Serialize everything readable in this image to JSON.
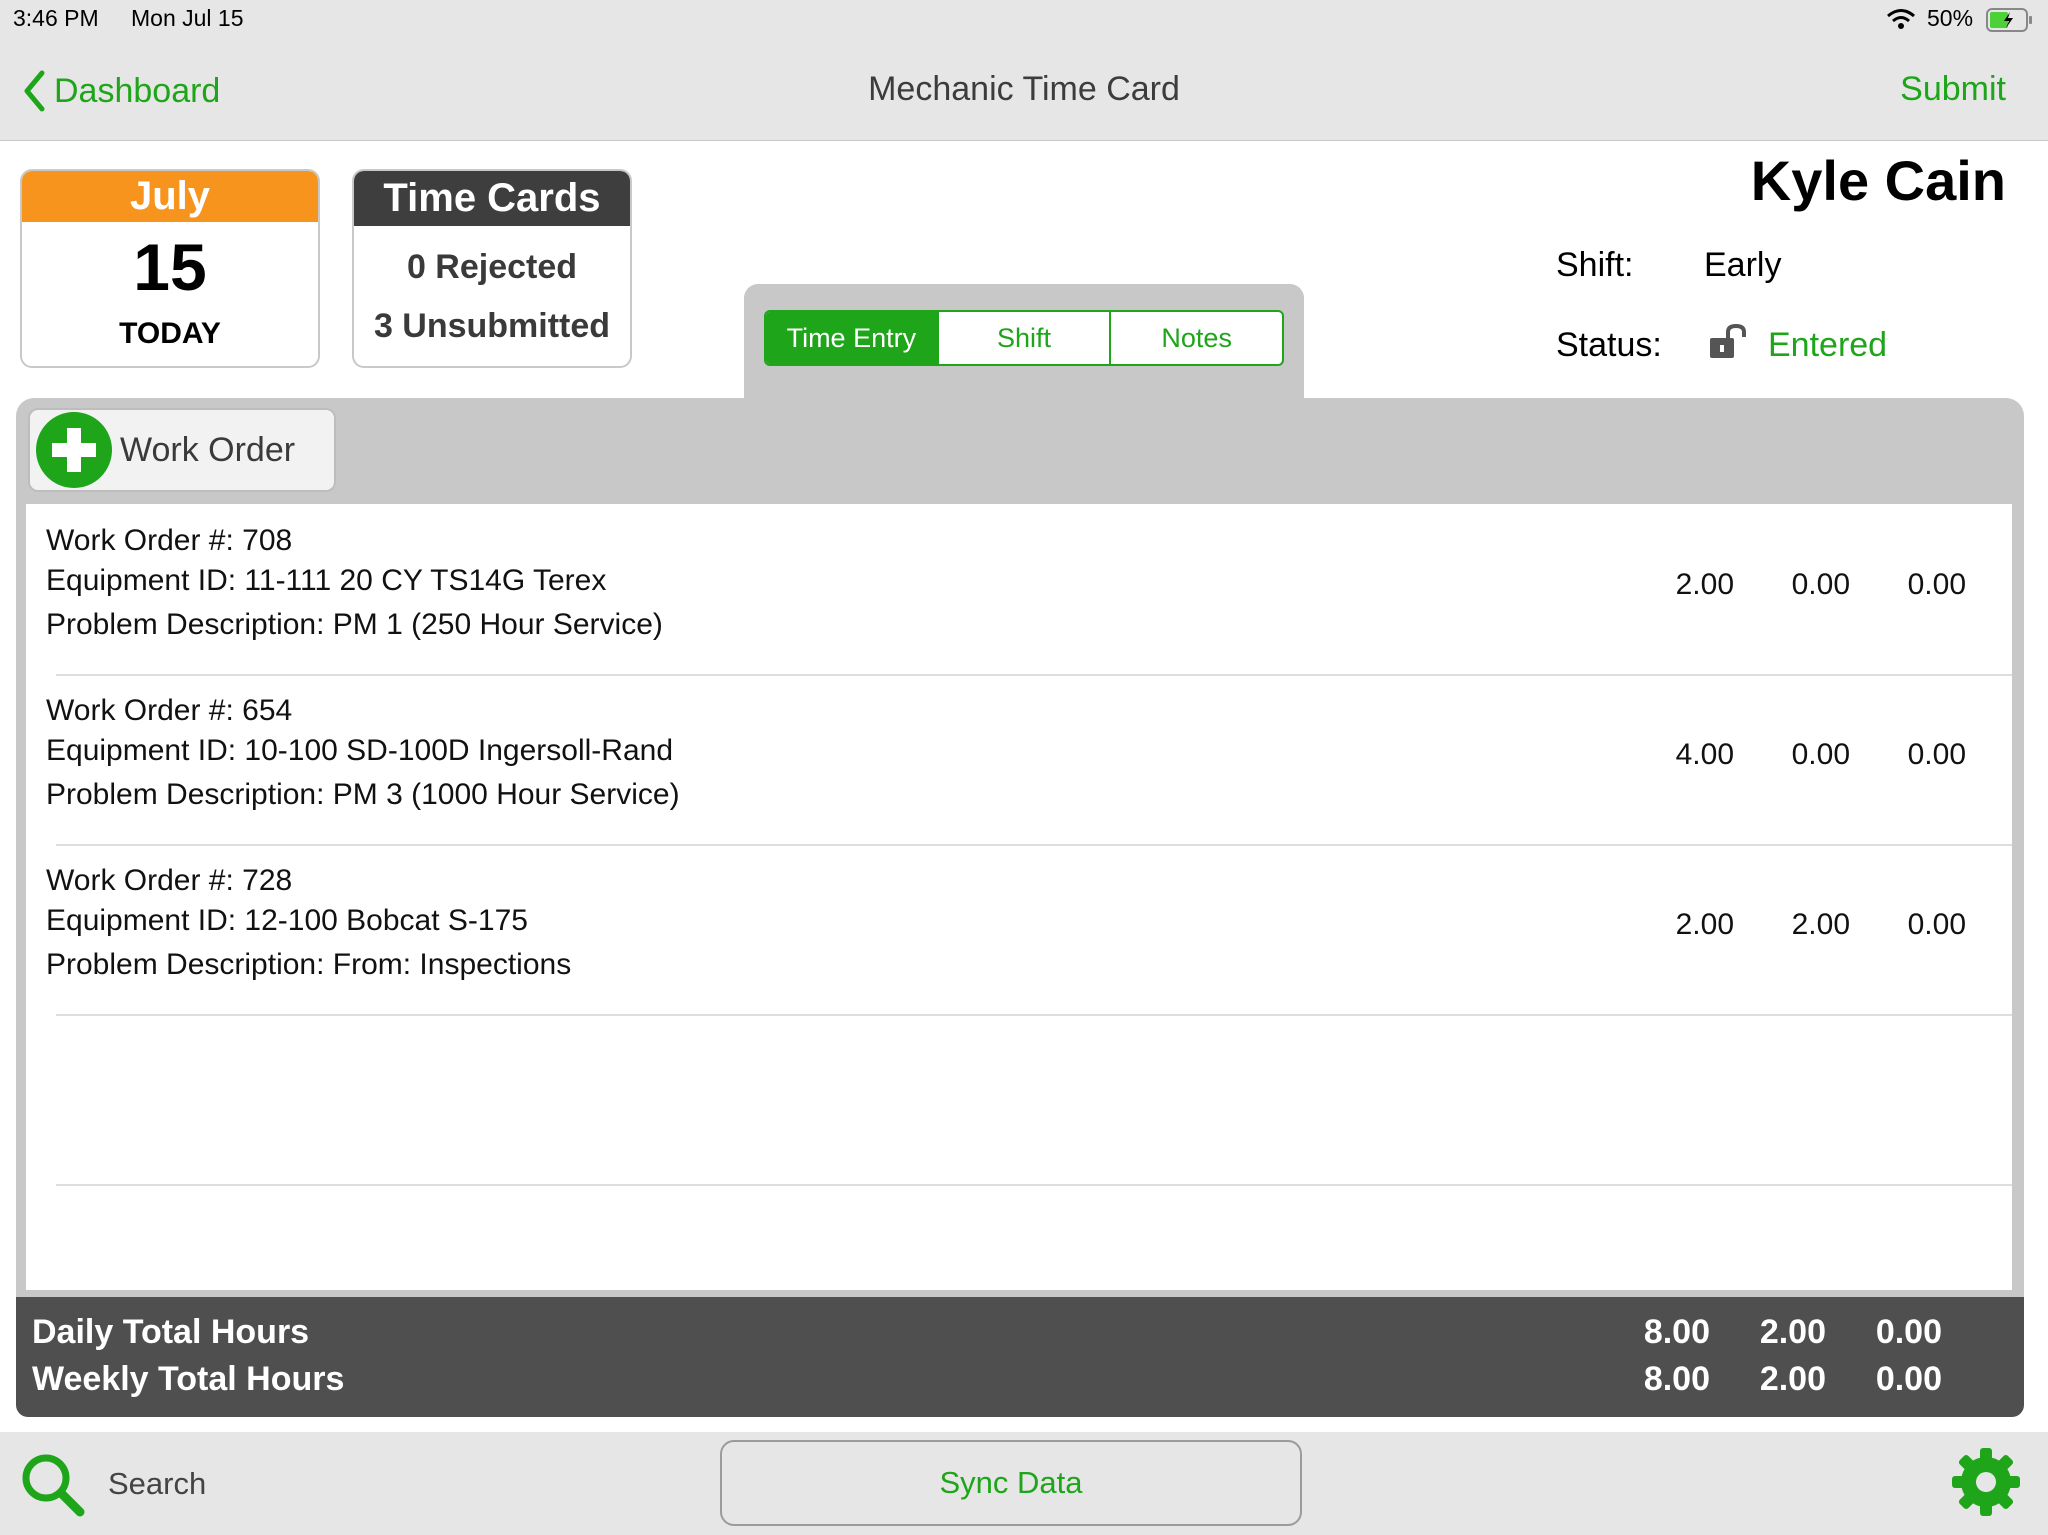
{
  "status_bar": {
    "time": "3:46 PM",
    "date": "Mon Jul 15",
    "battery": "50%"
  },
  "nav": {
    "back_label": "Dashboard",
    "title": "Mechanic Time Card",
    "submit_label": "Submit"
  },
  "date_card": {
    "month": "July",
    "day": "15",
    "label": "TODAY"
  },
  "time_cards": {
    "title": "Time Cards",
    "rejected": "0 Rejected",
    "unsubmitted": "3 Unsubmitted"
  },
  "tabs": [
    {
      "label": "Time Entry",
      "active": true
    },
    {
      "label": "Shift",
      "active": false
    },
    {
      "label": "Notes",
      "active": false
    }
  ],
  "employee": {
    "name": "Kyle Cain",
    "shift_label": "Shift:",
    "shift_value": "Early",
    "status_label": "Status:",
    "status_value": "Entered"
  },
  "add_work_order_label": "Work Order",
  "work_orders": [
    {
      "wo": "Work Order #: 708",
      "equipment": "Equipment ID: 11-111  20 CY TS14G Terex",
      "problem": "Problem Description: PM 1 (250 Hour Service)",
      "h1": "2.00",
      "h2": "0.00",
      "h3": "0.00"
    },
    {
      "wo": "Work Order #: 654",
      "equipment": "Equipment ID: 10-100  SD-100D Ingersoll-Rand",
      "problem": "Problem Description: PM 3 (1000 Hour Service)",
      "h1": "4.00",
      "h2": "0.00",
      "h3": "0.00"
    },
    {
      "wo": "Work Order #: 728",
      "equipment": "Equipment ID: 12-100  Bobcat S-175",
      "problem": "Problem Description: From: Inspections",
      "h1": "2.00",
      "h2": "2.00",
      "h3": "0.00"
    }
  ],
  "totals": {
    "daily_label": "Daily Total Hours",
    "daily": [
      "8.00",
      "2.00",
      "0.00"
    ],
    "weekly_label": "Weekly Total Hours",
    "weekly": [
      "8.00",
      "2.00",
      "0.00"
    ]
  },
  "bottom": {
    "search_placeholder": "Search",
    "sync_label": "Sync Data"
  },
  "colors": {
    "accent": "#1ea51a",
    "month_header": "#f7941d",
    "dark_header": "#3e3e3e",
    "totals_bg": "#4f4f4f"
  }
}
